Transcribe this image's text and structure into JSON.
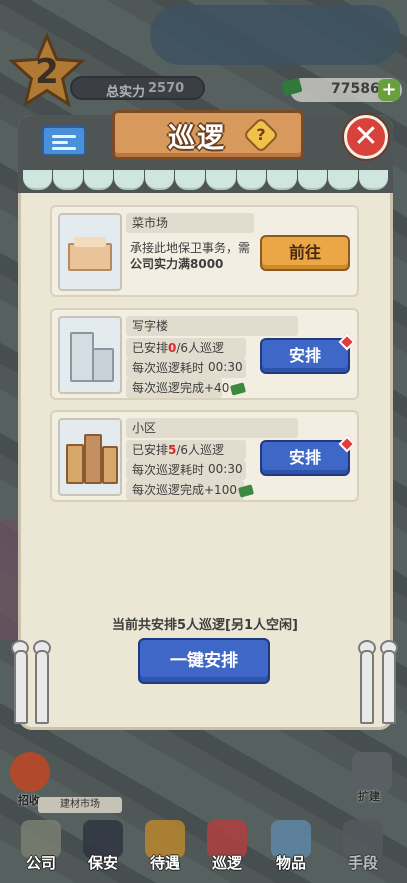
{
  "hud": {
    "level": "2",
    "power_label": "总实力",
    "power_value": "2570",
    "money_value": "77586",
    "money_plus": "+"
  },
  "dialog": {
    "title": "巡逻",
    "help_symbol": "?",
    "close_symbol": "✕"
  },
  "cards": [
    {
      "name": "菜市场",
      "line1": "承接此地保卫事务，需",
      "line2": "公司实力满8000",
      "button": "前往",
      "button_type": "goto"
    },
    {
      "name": "写字楼",
      "assigned_prefix": "已安排",
      "assigned_now": "0",
      "assigned_suffix": "/6人巡逻",
      "time_label": "每次巡逻耗时",
      "time_value": "00:30",
      "reward_label": "每次巡逻完成+40",
      "button": "安排",
      "button_type": "arrange"
    },
    {
      "name": "小区",
      "assigned_prefix": "已安排",
      "assigned_now": "5",
      "assigned_suffix": "/6人巡逻",
      "time_label": "每次巡逻耗时",
      "time_value": "00:30",
      "reward_label": "每次巡逻完成+100",
      "button": "安排",
      "button_type": "arrange"
    }
  ],
  "summary": "当前共安排5人巡逻[另1人空闲]",
  "one_click_button": "一键安排",
  "side": {
    "recruit": "招收",
    "sign": "建材市场",
    "right_label": "扩建"
  },
  "bottom_nav": [
    "公司",
    "保安",
    "待遇",
    "巡逻",
    "物品",
    "手段"
  ],
  "colors": {
    "accent_blue": "#3f67c7",
    "accent_orange": "#eba746",
    "alert_red": "#d72a2a",
    "panel_bg": "#ece6d5"
  }
}
